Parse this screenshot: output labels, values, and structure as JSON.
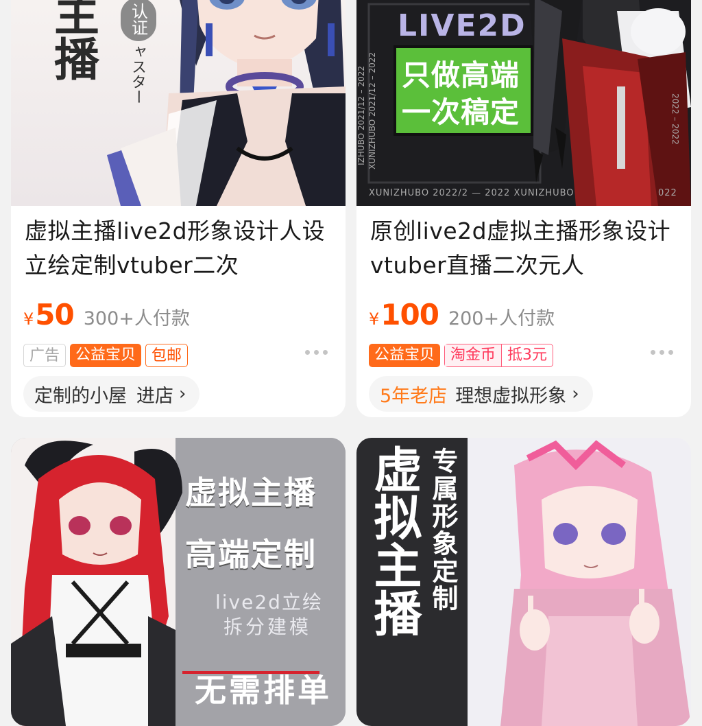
{
  "products": [
    {
      "image_text": {
        "big": "主播",
        "badge": "认证",
        "side": "ャスター"
      },
      "title": "虚拟主播live2d形象设计人设立绘定制vtuber二次",
      "currency": "¥",
      "price": "50",
      "pay_count": "300+人付款",
      "tags": {
        "ad": "广告",
        "charity": "公益宝贝",
        "shipping": "包邮"
      },
      "shop_name": "定制的小屋",
      "enter_label": "进店"
    },
    {
      "image_text": {
        "top": "LIVE2D",
        "green1": "只做高端",
        "green2": "一次稿定",
        "footer": "XUNIZHUBO 2022/2 — 2022   XUNIZHUBO",
        "footer_right": "022",
        "side_left": "IZHUBO 2021/12 – 2022",
        "side_left2": "XUNIZHUBO 2021/12 – 2022",
        "side_right": "2022 – 2022"
      },
      "title": "原创live2d虚拟主播形象设计vtuber直播二次元人",
      "currency": "¥",
      "price": "100",
      "pay_count": "200+人付款",
      "tags": {
        "charity": "公益宝贝",
        "coin": "淘金币",
        "discount": "抵3元"
      },
      "shop_badge": "5年老店",
      "shop_name": "理想虚拟形象"
    },
    {
      "image_text": {
        "line1": "虚拟主播",
        "line2": "高端定制",
        "line3": "live2d立绘",
        "line4": "拆分建模",
        "bottom": "无需排单"
      }
    },
    {
      "image_text": {
        "big": "虚拟主播",
        "side": "专属形象定制"
      }
    }
  ],
  "icons": {
    "more": "more-dots-icon",
    "arrow": "chevron-right-icon"
  },
  "colors": {
    "price": "#ff5000",
    "charity_tag": "#ff6a1a",
    "coin_tag": "#ff3a5c"
  }
}
